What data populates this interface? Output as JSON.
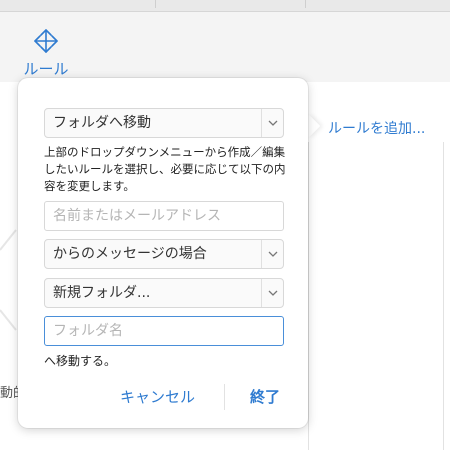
{
  "toolbar": {
    "rules_label": "ルール",
    "add_rule_label": "ルールを追加..."
  },
  "background": {
    "partial_text": "動的"
  },
  "popover": {
    "action_select": "フォルダへ移動",
    "description": "上部のドロップダウンメニューから作成／編集したいルールを選択し、必要に応じて以下の内容を変更します。",
    "sender_placeholder": "名前またはメールアドレス",
    "condition_select": "からのメッセージの場合",
    "folder_select": "新規フォルダ...",
    "folder_name_placeholder": "フォルダ名",
    "move_text": "へ移動する。",
    "cancel_label": "キャンセル",
    "done_label": "終了"
  },
  "colors": {
    "accent": "#2f7bd0",
    "focus_border": "#4a8fd9"
  },
  "icons": {
    "rules": "move-arrows-icon",
    "dropdown": "chevron-down-icon"
  }
}
